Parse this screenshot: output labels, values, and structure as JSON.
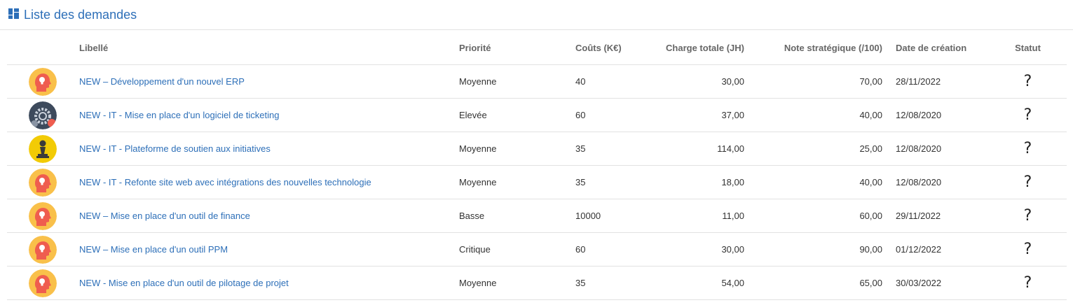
{
  "page": {
    "title": "Liste des demandes",
    "title_icon": "dashboard-icon",
    "accent": "#2d6fb8"
  },
  "table": {
    "columns": [
      "",
      "Libellé",
      "Priorité",
      "Coûts (K€)",
      "Charge totale (JH)",
      "Note stratégique (/100)",
      "Date de création",
      "Statut"
    ],
    "rows": [
      {
        "avatar": "idea-head-icon",
        "label": "NEW – Développement d'un nouvel ERP",
        "priority": "Moyenne",
        "cost": "40",
        "charge": "30,00",
        "note": "70,00",
        "date": "28/11/2022",
        "status": "?"
      },
      {
        "avatar": "gears-icon",
        "label": "NEW - IT - Mise en place d'un logiciel de ticketing",
        "priority": "Elevée",
        "cost": "60",
        "charge": "37,00",
        "note": "40,00",
        "date": "12/08/2020",
        "status": "?"
      },
      {
        "avatar": "chess-pawn-icon",
        "label": "NEW - IT - Plateforme de soutien aux initiatives",
        "priority": "Moyenne",
        "cost": "35",
        "charge": "114,00",
        "note": "25,00",
        "date": "12/08/2020",
        "status": "?"
      },
      {
        "avatar": "idea-head-icon",
        "label": "NEW - IT - Refonte site web avec intégrations des nouvelles technologie",
        "priority": "Moyenne",
        "cost": "35",
        "charge": "18,00",
        "note": "40,00",
        "date": "12/08/2020",
        "status": "?"
      },
      {
        "avatar": "idea-head-icon",
        "label": "NEW – Mise en place d'un outil de finance",
        "priority": "Basse",
        "cost": "10000",
        "charge": "11,00",
        "note": "60,00",
        "date": "29/11/2022",
        "status": "?"
      },
      {
        "avatar": "idea-head-icon",
        "label": "NEW – Mise en place d'un outil PPM",
        "priority": "Critique",
        "cost": "60",
        "charge": "30,00",
        "note": "90,00",
        "date": "01/12/2022",
        "status": "?"
      },
      {
        "avatar": "idea-head-icon",
        "label": "NEW - Mise en place d'un outil de pilotage de projet",
        "priority": "Moyenne",
        "cost": "35",
        "charge": "54,00",
        "note": "65,00",
        "date": "30/03/2022",
        "status": "?"
      }
    ]
  }
}
